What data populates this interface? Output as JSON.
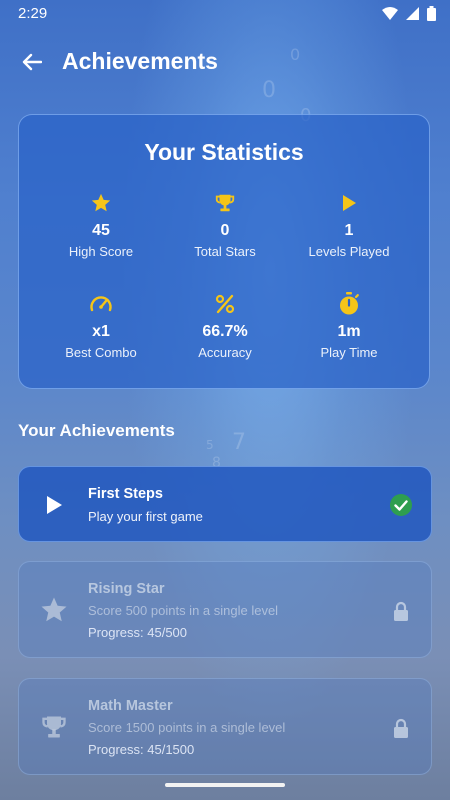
{
  "status_bar": {
    "time": "2:29"
  },
  "header": {
    "title": "Achievements"
  },
  "stats": {
    "title": "Your Statistics",
    "items": [
      {
        "icon": "star-icon",
        "value": "45",
        "label": "High Score"
      },
      {
        "icon": "trophy-icon",
        "value": "0",
        "label": "Total Stars"
      },
      {
        "icon": "play-icon",
        "value": "1",
        "label": "Levels Played"
      },
      {
        "icon": "speedometer-icon",
        "value": "x1",
        "label": "Best Combo"
      },
      {
        "icon": "percent-icon",
        "value": "66.7%",
        "label": "Accuracy"
      },
      {
        "icon": "stopwatch-icon",
        "value": "1m",
        "label": "Play Time"
      }
    ]
  },
  "achievements": {
    "title": "Your Achievements",
    "items": [
      {
        "icon": "play-icon",
        "title": "First Steps",
        "description": "Play your first game",
        "status": "unlocked"
      },
      {
        "icon": "star-icon",
        "title": "Rising Star",
        "description": "Score 500 points in a single level",
        "progress": "Progress: 45/500",
        "status": "locked"
      },
      {
        "icon": "trophy-icon",
        "title": "Math Master",
        "description": "Score 1500 points in a single level",
        "progress": "Progress: 45/1500",
        "status": "locked"
      }
    ]
  },
  "colors": {
    "accent_yellow": "#f5c518",
    "check_green": "#2e9e4f"
  }
}
